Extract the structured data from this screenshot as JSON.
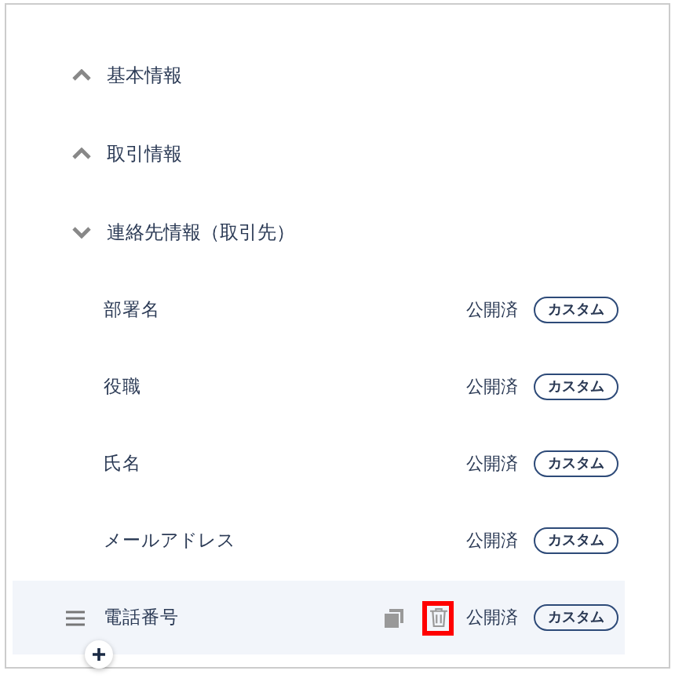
{
  "sections": [
    {
      "title": "基本情報",
      "expanded": false
    },
    {
      "title": "取引情報",
      "expanded": false
    },
    {
      "title": "連絡先情報（取引先）",
      "expanded": true
    }
  ],
  "fields": [
    {
      "name": "部署名",
      "status": "公開済",
      "badge": "カスタム",
      "hovered": false
    },
    {
      "name": "役職",
      "status": "公開済",
      "badge": "カスタム",
      "hovered": false
    },
    {
      "name": "氏名",
      "status": "公開済",
      "badge": "カスタム",
      "hovered": false
    },
    {
      "name": "メールアドレス",
      "status": "公開済",
      "badge": "カスタム",
      "hovered": false
    },
    {
      "name": "電話番号",
      "status": "公開済",
      "badge": "カスタム",
      "hovered": true,
      "delete_highlighted": true
    }
  ]
}
